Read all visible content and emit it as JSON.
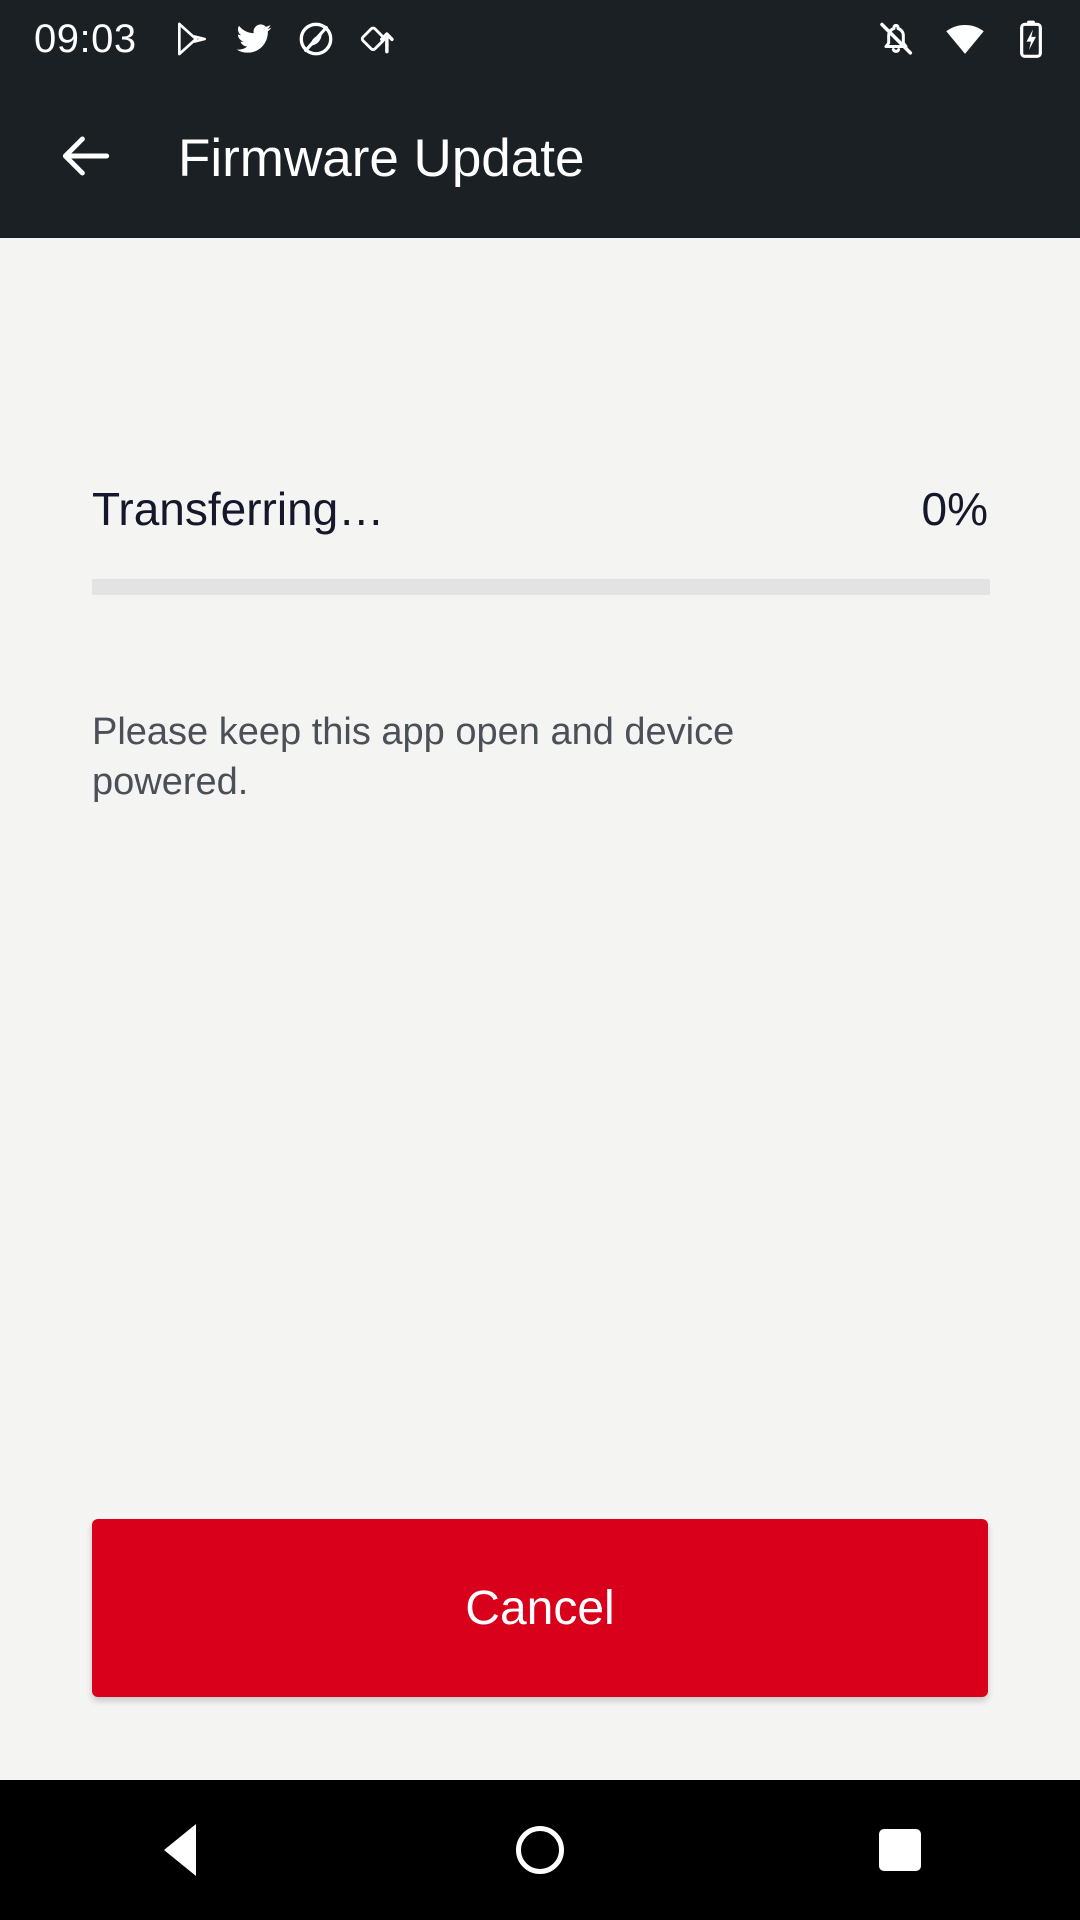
{
  "status_bar": {
    "time": "09:03",
    "left_icons": [
      "play-store-icon",
      "twitter-icon",
      "circle-app-icon",
      "diamond-upload-icon"
    ],
    "right_icons": [
      "notifications-off-icon",
      "wifi-icon",
      "battery-charging-icon"
    ],
    "background_color": "#1a2023"
  },
  "app_bar": {
    "back_icon": "arrow-left-icon",
    "title": "Firmware Update",
    "background_color": "#1a2023",
    "title_color": "#ffffff"
  },
  "main": {
    "progress": {
      "status_label": "Transferring…",
      "percent_label": "0%",
      "percent_value": 0,
      "track_color": "#e3e3e3",
      "fill_color": "#d9001b"
    },
    "hint": "Please keep this app open and device powered.",
    "background_color": "#f4f4f3",
    "text_color": "#15172a",
    "hint_color": "#4b5058"
  },
  "actions": {
    "cancel_label": "Cancel",
    "cancel_color": "#d9001b",
    "cancel_text_color": "#ffffff"
  },
  "nav_bar": {
    "back_icon": "nav-back-triangle-icon",
    "home_icon": "nav-home-circle-icon",
    "recents_icon": "nav-recents-square-icon",
    "background_color": "#000000"
  }
}
